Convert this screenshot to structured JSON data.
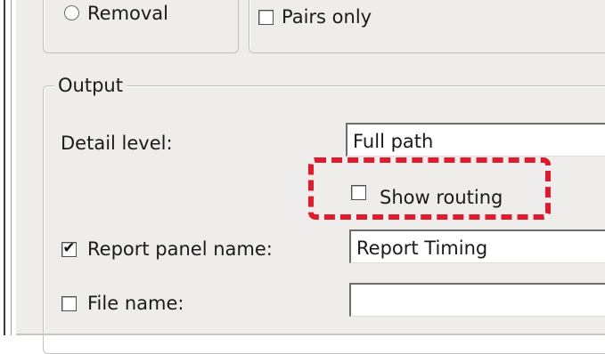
{
  "window": {
    "mode": {
      "removal_label": "Removal",
      "pairs_only_label": "Pairs only",
      "pairs_only_checked": false
    },
    "output": {
      "group_title": "Output",
      "detail_level": {
        "label": "Detail level:",
        "value": "Full path"
      },
      "show_routing": {
        "label": "Show routing",
        "checked": false
      },
      "report_panel_name": {
        "label": "Report panel name:",
        "checked": true,
        "value": "Report Timing"
      },
      "file_name": {
        "label": "File name:",
        "checked": false,
        "value": ""
      }
    },
    "check_glyph": "✔",
    "annotation_color": "#e11b2c"
  }
}
